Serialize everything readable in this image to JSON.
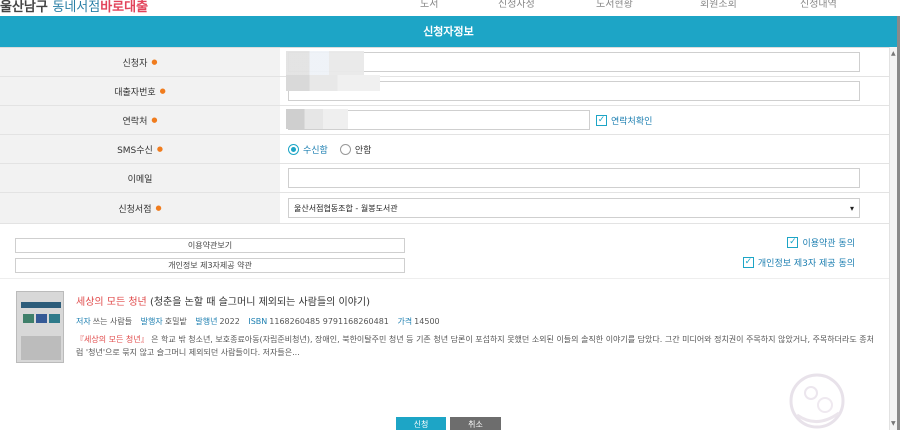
{
  "background": {
    "logo_part1": "울산남구",
    "logo_part2": "동네서점",
    "logo_part3": "바로대출",
    "nav": [
      "도서",
      "신청자정",
      "도서현황",
      "회원조회",
      "신청내역"
    ]
  },
  "modal": {
    "title": "신청자정보"
  },
  "form": {
    "applicant": {
      "label": "신청자",
      "value": ""
    },
    "loan_number": {
      "label": "대출자번호",
      "value": ""
    },
    "contact": {
      "label": "연락처",
      "value": "",
      "confirm_label": "연락처확인"
    },
    "sms": {
      "label": "SMS수신",
      "options": [
        "수신함",
        "안함"
      ],
      "selected": "수신함"
    },
    "email": {
      "label": "이메일",
      "value": ""
    },
    "bookstore": {
      "label": "신청서점",
      "selected": "울산서점협동조합 - 월봉도서관"
    }
  },
  "agreements": {
    "terms_view_button": "이용약관보기",
    "privacy_view_button": "개인정보 제3자제공 약관",
    "terms_agree": "이용약관 동의",
    "privacy_agree": "개인정보 제3자 제공 동의"
  },
  "book": {
    "title": "세상의 모든 청년",
    "subtitle": "(청춘을 논할 때 슬그머니 제외되는 사람들의 이야기)",
    "author_key": "저자",
    "author": "쓰는 사람들",
    "publisher_key": "발행자",
    "publisher": "호밀밭",
    "year_key": "발행년",
    "year": "2022",
    "isbn_key": "ISBN",
    "isbn": "1168260485 9791168260481",
    "price_key": "가격",
    "price": "14500",
    "desc_title": "『세상의 모든 청년』",
    "desc_text": "은 학교 밖 청소년, 보호종료아동(자립준비청년), 장애인, 북한이탈주민 청년 등 기존 청년 담론이 포섭하지 못했던 소외된 이들의 솔직한 이야기를 담았다. 그간 미디어와 정치권이 주목하지 않았거나, 주목하더라도 종처럼 '청년'으로 묶지 않고 슬그머니 제외되던 사람들이다. 저자들은..."
  },
  "buttons": {
    "apply": "신청",
    "cancel": "취소"
  },
  "colors": {
    "header": "#1da5c6",
    "required_dot": "#f07c1e",
    "link": "#1d7fb1",
    "book_title": "#e04a4a"
  }
}
